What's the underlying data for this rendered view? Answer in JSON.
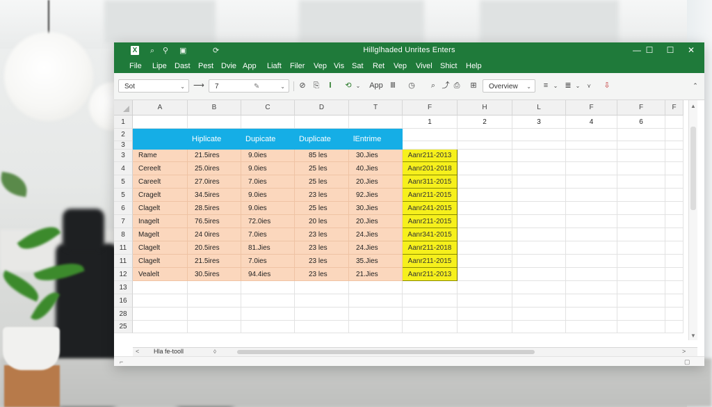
{
  "window": {
    "title": "Hillglhaded Unrites Enters",
    "logo": "X",
    "quick_icons": [
      "⌕",
      "⚲",
      "▣",
      "⟳"
    ],
    "controls": [
      "—",
      "☐",
      "☐",
      "✕"
    ]
  },
  "menu": [
    "File",
    "Lipe",
    "Dast",
    "Pest",
    "Dvie",
    "App",
    "Liaft",
    "Filer",
    "Vep",
    "Vis",
    "Sat",
    "Ret",
    "Vep",
    "Vivel",
    "Shict",
    "Help"
  ],
  "toolbar": {
    "font_value": "Sot",
    "size_value": "7",
    "app_label": "App",
    "view_label": "Overview",
    "icons": [
      "⟶",
      "✎",
      "⊘",
      "⎘",
      "𝐈",
      "⟲",
      "⌕",
      "⤴",
      "⎙",
      "⊞",
      "≡",
      "≣",
      "⋎",
      "⇩"
    ]
  },
  "columns": [
    "A",
    "B",
    "C",
    "D",
    "T",
    "F",
    "H",
    "L",
    "F",
    "F",
    "F"
  ],
  "row_numbers": [
    "1",
    "2",
    "3",
    "3",
    "4",
    "5",
    "5",
    "6",
    "7",
    "8",
    "11",
    "11",
    "12",
    "13",
    "16",
    "28",
    "25"
  ],
  "row1_values": [
    "1",
    "2",
    "3",
    "4",
    "6"
  ],
  "table": {
    "headers": [
      "Hiplicate",
      "Dupicate",
      "Duplicate",
      "lEntrime"
    ],
    "rows": [
      [
        "Rame",
        "21.5ires",
        "9.0ies",
        "85 les",
        "30.Jies",
        "Aanr211-2013"
      ],
      [
        "Cereelt",
        "25.0ires",
        "9.0ies",
        "25 les",
        "40.Jies",
        "Aanr201-2018"
      ],
      [
        "Careelt",
        "27.0ires",
        "7.0ies",
        "25 les",
        "20.Jies",
        "Aanr311-2015"
      ],
      [
        "Cragelt",
        "34.5ires",
        "9.0ies",
        "23 les",
        "92.Jies",
        "Aanr211-2015"
      ],
      [
        "Clagelt",
        "28.5ires",
        "9.0ies",
        "25 les",
        "30.Jies",
        "Aanr241-2015"
      ],
      [
        "Inagelt",
        "76.5ires",
        "72.0ies",
        "20 les",
        "20.Jies",
        "Aanr211-2015"
      ],
      [
        "Magelt",
        "24 0ires",
        "7.0ies",
        "23 les",
        "24.Jies",
        "Aanr341-2015"
      ],
      [
        "Clagelt",
        "20.5ires",
        "81.Jies",
        "23 les",
        "24.Jies",
        "Aanr211-2018"
      ],
      [
        "Clagelt",
        "21.5ires",
        "7.0ies",
        "23 les",
        "35.Jies",
        "Aanr211-2015"
      ],
      [
        "Vealelt",
        "30.5ires",
        "94.4ies",
        "23 les",
        "21.Jies",
        "Aanr211-2013"
      ]
    ]
  },
  "sheet": {
    "nav_left": "<",
    "tab_label": "Hla fe-tooll",
    "nav_right": ">"
  },
  "colors": {
    "titlebar": "#1f7a3a",
    "header_fill": "#15aee6",
    "data_fill": "#fbd7bd",
    "date_fill": "#f6f01c"
  }
}
